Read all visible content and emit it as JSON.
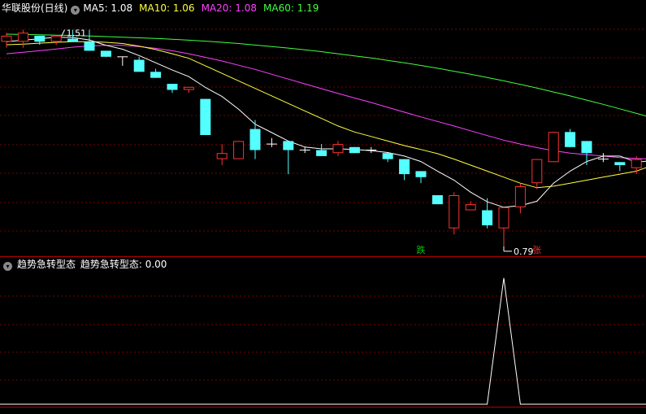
{
  "main_header": {
    "title": "华联股份(日线)",
    "ma_labels": [
      {
        "text": "MA5: 1.08",
        "color": "#ffffff"
      },
      {
        "text": "MA10: 1.06",
        "color": "#ffff40"
      },
      {
        "text": "MA20: 1.08",
        "color": "#ff40ff"
      },
      {
        "text": "MA60: 1.19",
        "color": "#40ff40"
      }
    ]
  },
  "indicator_header": {
    "title": "趋势急转型态",
    "value_text": "趋势急转型态: 0.00",
    "color": "#ffffff"
  },
  "colors": {
    "up": "#ff3232",
    "down": "#54ffff",
    "grid": "#7a0000",
    "border": "#b00000",
    "ma5": "#ffffff",
    "ma10": "#ffff40",
    "ma20": "#ff40ff",
    "ma60": "#40ff40",
    "text": "#c8c8c8"
  },
  "chart_data": [
    {
      "type": "candlestick",
      "title": "华联股份(日线)",
      "ylim": [
        0.76,
        1.56
      ],
      "candles": [
        {
          "o": 1.47,
          "h": 1.5,
          "l": 1.45,
          "c": 1.49
        },
        {
          "o": 1.47,
          "h": 1.51,
          "l": 1.45,
          "c": 1.5
        },
        {
          "o": 1.49,
          "h": 1.49,
          "l": 1.46,
          "c": 1.47
        },
        {
          "o": 1.47,
          "h": 1.49,
          "l": 1.46,
          "c": 1.49
        },
        {
          "o": 1.48,
          "h": 1.51,
          "l": 1.47,
          "c": 1.47
        },
        {
          "o": 1.47,
          "h": 1.51,
          "l": 1.44,
          "c": 1.44
        },
        {
          "o": 1.44,
          "h": 1.44,
          "l": 1.42,
          "c": 1.42
        },
        {
          "o": 1.42,
          "h": 1.42,
          "l": 1.39,
          "c": 1.42
        },
        {
          "o": 1.41,
          "h": 1.42,
          "l": 1.37,
          "c": 1.37
        },
        {
          "o": 1.37,
          "h": 1.38,
          "l": 1.35,
          "c": 1.35
        },
        {
          "o": 1.33,
          "h": 1.33,
          "l": 1.3,
          "c": 1.31
        },
        {
          "o": 1.31,
          "h": 1.32,
          "l": 1.3,
          "c": 1.32
        },
        {
          "o": 1.28,
          "h": 1.28,
          "l": 1.16,
          "c": 1.16
        },
        {
          "o": 1.08,
          "h": 1.13,
          "l": 1.06,
          "c": 1.1
        },
        {
          "o": 1.08,
          "h": 1.14,
          "l": 1.08,
          "c": 1.14
        },
        {
          "o": 1.18,
          "h": 1.21,
          "l": 1.08,
          "c": 1.11
        },
        {
          "o": 1.13,
          "h": 1.15,
          "l": 1.12,
          "c": 1.13
        },
        {
          "o": 1.14,
          "h": 1.14,
          "l": 1.03,
          "c": 1.11
        },
        {
          "o": 1.11,
          "h": 1.12,
          "l": 1.1,
          "c": 1.11
        },
        {
          "o": 1.11,
          "h": 1.13,
          "l": 1.1,
          "c": 1.09
        },
        {
          "o": 1.1,
          "h": 1.14,
          "l": 1.09,
          "c": 1.13
        },
        {
          "o": 1.12,
          "h": 1.12,
          "l": 1.1,
          "c": 1.1
        },
        {
          "o": 1.11,
          "h": 1.12,
          "l": 1.1,
          "c": 1.11
        },
        {
          "o": 1.1,
          "h": 1.1,
          "l": 1.07,
          "c": 1.08
        },
        {
          "o": 1.08,
          "h": 1.08,
          "l": 1.01,
          "c": 1.03
        },
        {
          "o": 1.04,
          "h": 1.04,
          "l": 1.0,
          "c": 1.02
        },
        {
          "o": 0.96,
          "h": 0.96,
          "l": 0.93,
          "c": 0.93
        },
        {
          "o": 0.85,
          "h": 0.97,
          "l": 0.83,
          "c": 0.96
        },
        {
          "o": 0.91,
          "h": 0.94,
          "l": 0.91,
          "c": 0.93
        },
        {
          "o": 0.91,
          "h": 0.95,
          "l": 0.85,
          "c": 0.86
        },
        {
          "o": 0.85,
          "h": 0.92,
          "l": 0.79,
          "c": 0.92
        },
        {
          "o": 0.92,
          "h": 1.0,
          "l": 0.9,
          "c": 0.99
        },
        {
          "o": 1.0,
          "h": 1.08,
          "l": 0.98,
          "c": 1.08
        },
        {
          "o": 1.07,
          "h": 1.17,
          "l": 1.07,
          "c": 1.17
        },
        {
          "o": 1.17,
          "h": 1.18,
          "l": 1.12,
          "c": 1.12
        },
        {
          "o": 1.14,
          "h": 1.14,
          "l": 1.06,
          "c": 1.1
        },
        {
          "o": 1.08,
          "h": 1.1,
          "l": 1.07,
          "c": 1.08
        },
        {
          "o": 1.07,
          "h": 1.07,
          "l": 1.04,
          "c": 1.06
        },
        {
          "o": 1.05,
          "h": 1.09,
          "l": 1.03,
          "c": 1.08
        },
        {
          "o": 1.08,
          "h": 1.1,
          "l": 1.06,
          "c": 1.08
        }
      ],
      "ma5": [
        1.47,
        1.475,
        1.48,
        1.485,
        1.484,
        1.476,
        1.458,
        1.445,
        1.424,
        1.4,
        1.376,
        1.354,
        1.318,
        1.288,
        1.246,
        1.196,
        1.168,
        1.14,
        1.12,
        1.114,
        1.114,
        1.112,
        1.108,
        1.102,
        1.09,
        1.072,
        1.04,
        1.01,
        0.97,
        0.938,
        0.92,
        0.925,
        0.94,
        1.0,
        1.04,
        1.072,
        1.09,
        1.09,
        1.07,
        1.075
      ],
      "ma10": [
        1.46,
        1.462,
        1.465,
        1.468,
        1.47,
        1.47,
        1.468,
        1.464,
        1.455,
        1.444,
        1.43,
        1.415,
        1.39,
        1.365,
        1.34,
        1.315,
        1.29,
        1.265,
        1.24,
        1.215,
        1.19,
        1.17,
        1.155,
        1.14,
        1.125,
        1.112,
        1.098,
        1.08,
        1.06,
        1.04,
        1.02,
        1.0,
        0.985,
        0.99,
        1.0,
        1.01,
        1.02,
        1.03,
        1.04,
        1.06
      ],
      "ma20": [
        1.43,
        1.435,
        1.44,
        1.446,
        1.452,
        1.456,
        1.458,
        1.458,
        1.454,
        1.448,
        1.44,
        1.43,
        1.418,
        1.406,
        1.392,
        1.378,
        1.362,
        1.346,
        1.33,
        1.314,
        1.298,
        1.283,
        1.268,
        1.252,
        1.236,
        1.22,
        1.205,
        1.19,
        1.174,
        1.158,
        1.143,
        1.13,
        1.118,
        1.108,
        1.1,
        1.095,
        1.09,
        1.085,
        1.082,
        1.08
      ],
      "ma60": [
        1.495,
        1.494,
        1.493,
        1.492,
        1.491,
        1.489,
        1.487,
        1.485,
        1.483,
        1.481,
        1.478,
        1.475,
        1.472,
        1.468,
        1.464,
        1.459,
        1.454,
        1.449,
        1.443,
        1.437,
        1.43,
        1.423,
        1.416,
        1.408,
        1.4,
        1.391,
        1.382,
        1.372,
        1.362,
        1.351,
        1.34,
        1.328,
        1.316,
        1.303,
        1.29,
        1.276,
        1.262,
        1.247,
        1.232,
        1.217
      ],
      "annotations": [
        {
          "text": "1.51",
          "index": 4,
          "value": 1.51,
          "kind": "high"
        },
        {
          "text": "0.79",
          "index": 30,
          "value": 0.79,
          "kind": "low"
        },
        {
          "text": "跌",
          "index": 25,
          "kind": "sell",
          "color": "#00c800"
        },
        {
          "text": "张",
          "index": 32,
          "kind": "buy",
          "color": "#ff3232"
        }
      ]
    },
    {
      "type": "line",
      "title": "趋势急转型态",
      "series": [
        {
          "name": "趋势急转型态",
          "values": [
            0,
            0,
            0,
            0,
            0,
            0,
            0,
            0,
            0,
            0,
            0,
            0,
            0,
            0,
            0,
            0,
            0,
            0,
            0,
            0,
            0,
            0,
            0,
            0,
            0,
            0,
            0,
            0,
            0,
            0,
            1,
            0,
            0,
            0,
            0,
            0,
            0,
            0,
            0,
            0
          ]
        }
      ],
      "ylim": [
        0,
        1.05
      ]
    }
  ]
}
